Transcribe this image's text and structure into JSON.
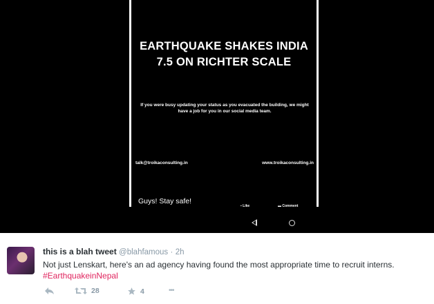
{
  "ad_image": {
    "title_line1": "EARTHQUAKE SHAKES INDIA",
    "title_line2": "7.5 ON RICHTER SCALE",
    "body": "If you were busy updating your status as you evacuated the building, we might have a job for you in our social media team.",
    "email": "talk@troikaconsulting.in",
    "website": "www.troikaconsulting.in",
    "caption": "Guys! Stay safe!",
    "like_label": "Like",
    "comment_label": "Comment"
  },
  "tweet": {
    "author_name": "this is a blah tweet",
    "handle": "@blahfamous",
    "separator": "·",
    "time": "2h",
    "text": "Not just Lenskart, here's an ad agency having found the most appropriate time to recruit interns.",
    "hashtag": "#EarthquakeinNepal",
    "retweet_count": "28",
    "favorite_count": "4",
    "more_label": "•••"
  },
  "colors": {
    "hashtag": "#e0245e",
    "meta_gray": "#8899a6",
    "text": "#292f33",
    "image_bg": "#000000"
  },
  "icons": [
    "back-icon",
    "home-icon",
    "like-icon",
    "comment-icon",
    "reply-icon",
    "retweet-icon",
    "star-icon",
    "more-icon"
  ]
}
